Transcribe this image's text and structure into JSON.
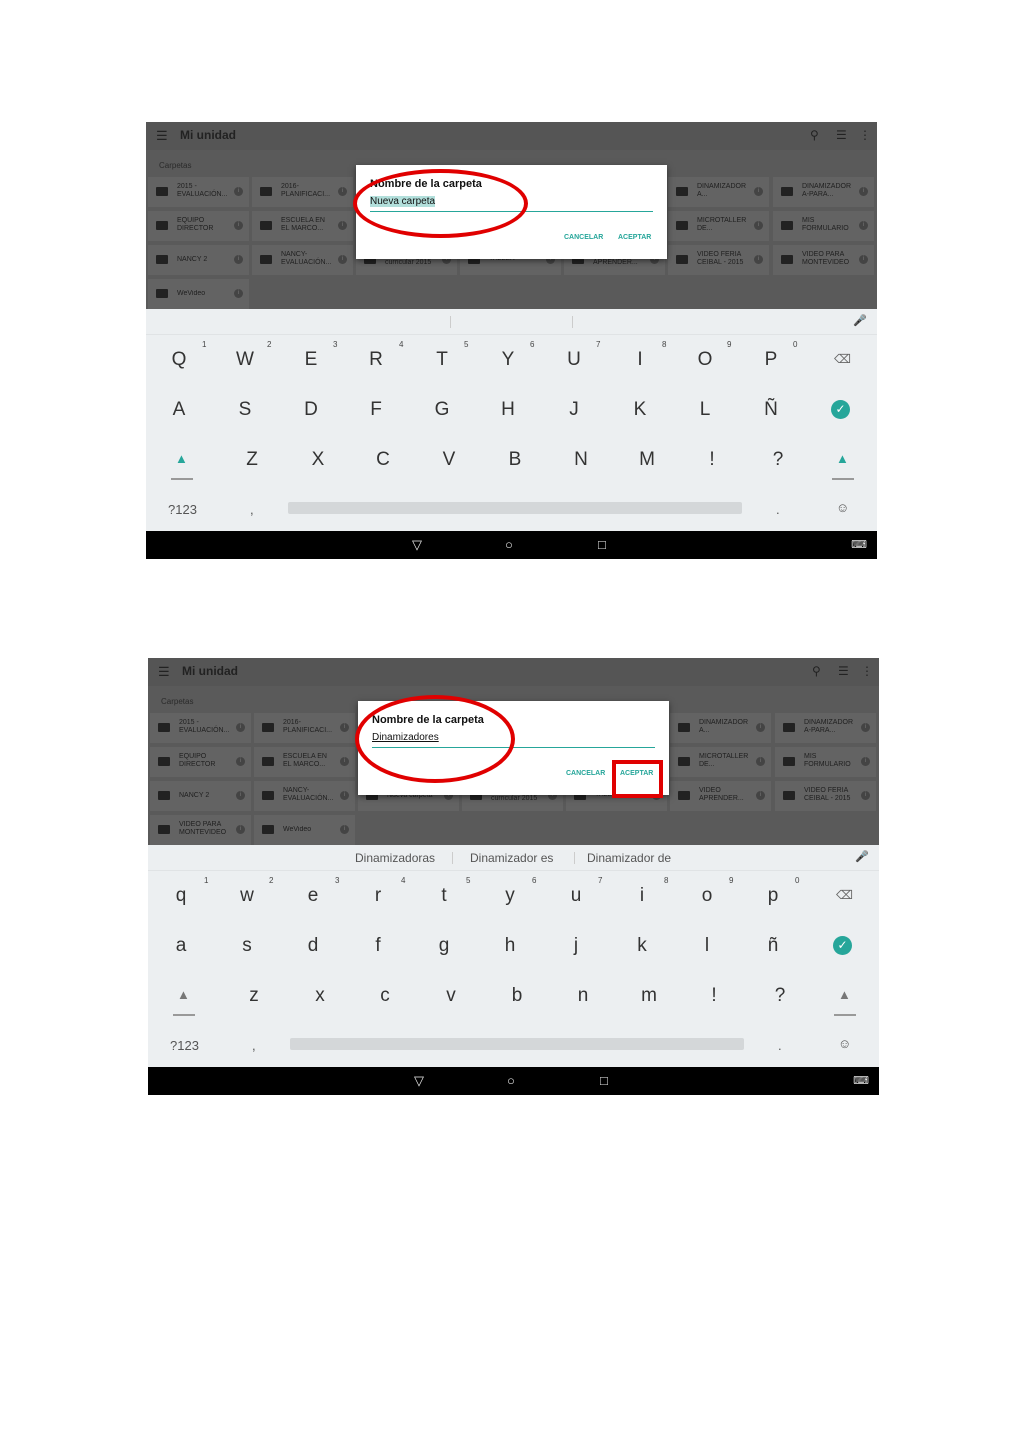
{
  "screens": [
    {
      "app_title": "Mi unidad",
      "section_label": "Carpetas",
      "folders": [
        {
          "name": "2015 -\nEVALUACIÓN..."
        },
        {
          "name": "2016-\nPLANIFICACI..."
        },
        {
          "name": "DINAMIZADOR\nA..."
        },
        {
          "name": "DINAMIZADOR\nA-PARA..."
        },
        {
          "name": "EQUIPO\nDIRECTOR"
        },
        {
          "name": "ESCUELA EN\nEL MARCO..."
        },
        {
          "name": "MICROTALLER\nDE..."
        },
        {
          "name": "MIS\nFORMULARIO"
        },
        {
          "name": "NANCY 2"
        },
        {
          "name": "NANCY-\nEVALUACIÓN..."
        },
        {
          "name": "curricular 2015"
        },
        {
          "name": "TALLER"
        },
        {
          "name": "APRENDER..."
        },
        {
          "name": "VIDEO FERIA\nCEIBAL - 2015"
        },
        {
          "name": "VIDEO PARA\nMONTEVIDEO"
        },
        {
          "name": "WeVideo"
        }
      ],
      "dialog": {
        "title": "Nombre de la carpeta",
        "input_value": "Nueva carpeta",
        "cancel_label": "CANCELAR",
        "accept_label": "ACEPTAR"
      },
      "suggestions": [
        "",
        "",
        ""
      ],
      "keyboard": {
        "row1": [
          "Q",
          "W",
          "E",
          "R",
          "T",
          "Y",
          "U",
          "I",
          "O",
          "P"
        ],
        "row1_hints": [
          "1",
          "2",
          "3",
          "4",
          "5",
          "6",
          "7",
          "8",
          "9",
          "0"
        ],
        "row2": [
          "A",
          "S",
          "D",
          "F",
          "G",
          "H",
          "J",
          "K",
          "L",
          "Ñ"
        ],
        "row3": [
          "Z",
          "X",
          "C",
          "V",
          "B",
          "N",
          "M",
          "!",
          "?"
        ],
        "symbols_label": "?123",
        "comma": ",",
        "period": "."
      }
    },
    {
      "app_title": "Mi unidad",
      "section_label": "Carpetas",
      "folders": [
        {
          "name": "2015 -\nEVALUACIÓN..."
        },
        {
          "name": "2016-\nPLANIFICACI..."
        },
        {
          "name": "DINAMIZADOR\nA..."
        },
        {
          "name": "DINAMIZADOR\nA-PARA..."
        },
        {
          "name": "EQUIPO\nDIRECTOR"
        },
        {
          "name": "ESCUELA EN\nEL MARCO..."
        },
        {
          "name": "MICROTALLER\nDE..."
        },
        {
          "name": "MIS\nFORMULARIO"
        },
        {
          "name": "NANCY 2"
        },
        {
          "name": "NANCY-\nEVALUACIÓN..."
        },
        {
          "name": "Nueva carpeta"
        },
        {
          "name": "curricular 2015"
        },
        {
          "name": "TALLER"
        },
        {
          "name": "VIDEO\nAPRENDER..."
        },
        {
          "name": "VIDEO FERIA\nCEIBAL - 2015"
        },
        {
          "name": "VIDEO PARA\nMONTEVIDEO"
        },
        {
          "name": "WeVideo"
        }
      ],
      "dialog": {
        "title": "Nombre de la carpeta",
        "input_value": "Dinamizadores",
        "cancel_label": "CANCELAR",
        "accept_label": "ACEPTAR"
      },
      "suggestions": [
        "Dinamizadoras",
        "Dinamizador es",
        "Dinamizador de"
      ],
      "keyboard": {
        "row1": [
          "q",
          "w",
          "e",
          "r",
          "t",
          "y",
          "u",
          "i",
          "o",
          "p"
        ],
        "row1_hints": [
          "1",
          "2",
          "3",
          "4",
          "5",
          "6",
          "7",
          "8",
          "9",
          "0"
        ],
        "row2": [
          "a",
          "s",
          "d",
          "f",
          "g",
          "h",
          "j",
          "k",
          "l",
          "ñ"
        ],
        "row3": [
          "z",
          "x",
          "c",
          "v",
          "b",
          "n",
          "m",
          "!",
          "?"
        ],
        "symbols_label": "?123",
        "comma": ",",
        "period": "."
      }
    }
  ],
  "icons": {
    "menu": "menu-icon",
    "search": "search-icon",
    "list_view": "list-view-icon",
    "more": "more-vert-icon",
    "folder": "folder-icon",
    "info": "info-icon",
    "mic": "mic-icon",
    "backspace": "backspace-icon",
    "enter": "check-icon",
    "shift": "shift-icon",
    "emoji": "emoji-icon",
    "back": "nav-back-icon",
    "home": "nav-home-icon",
    "recents": "nav-recents-icon",
    "keyboard": "keyboard-icon"
  },
  "colors": {
    "accent": "#26a69a",
    "annotation": "#e00000",
    "overlay": "#5a5a5a",
    "keyboard_bg": "#eceff1"
  }
}
